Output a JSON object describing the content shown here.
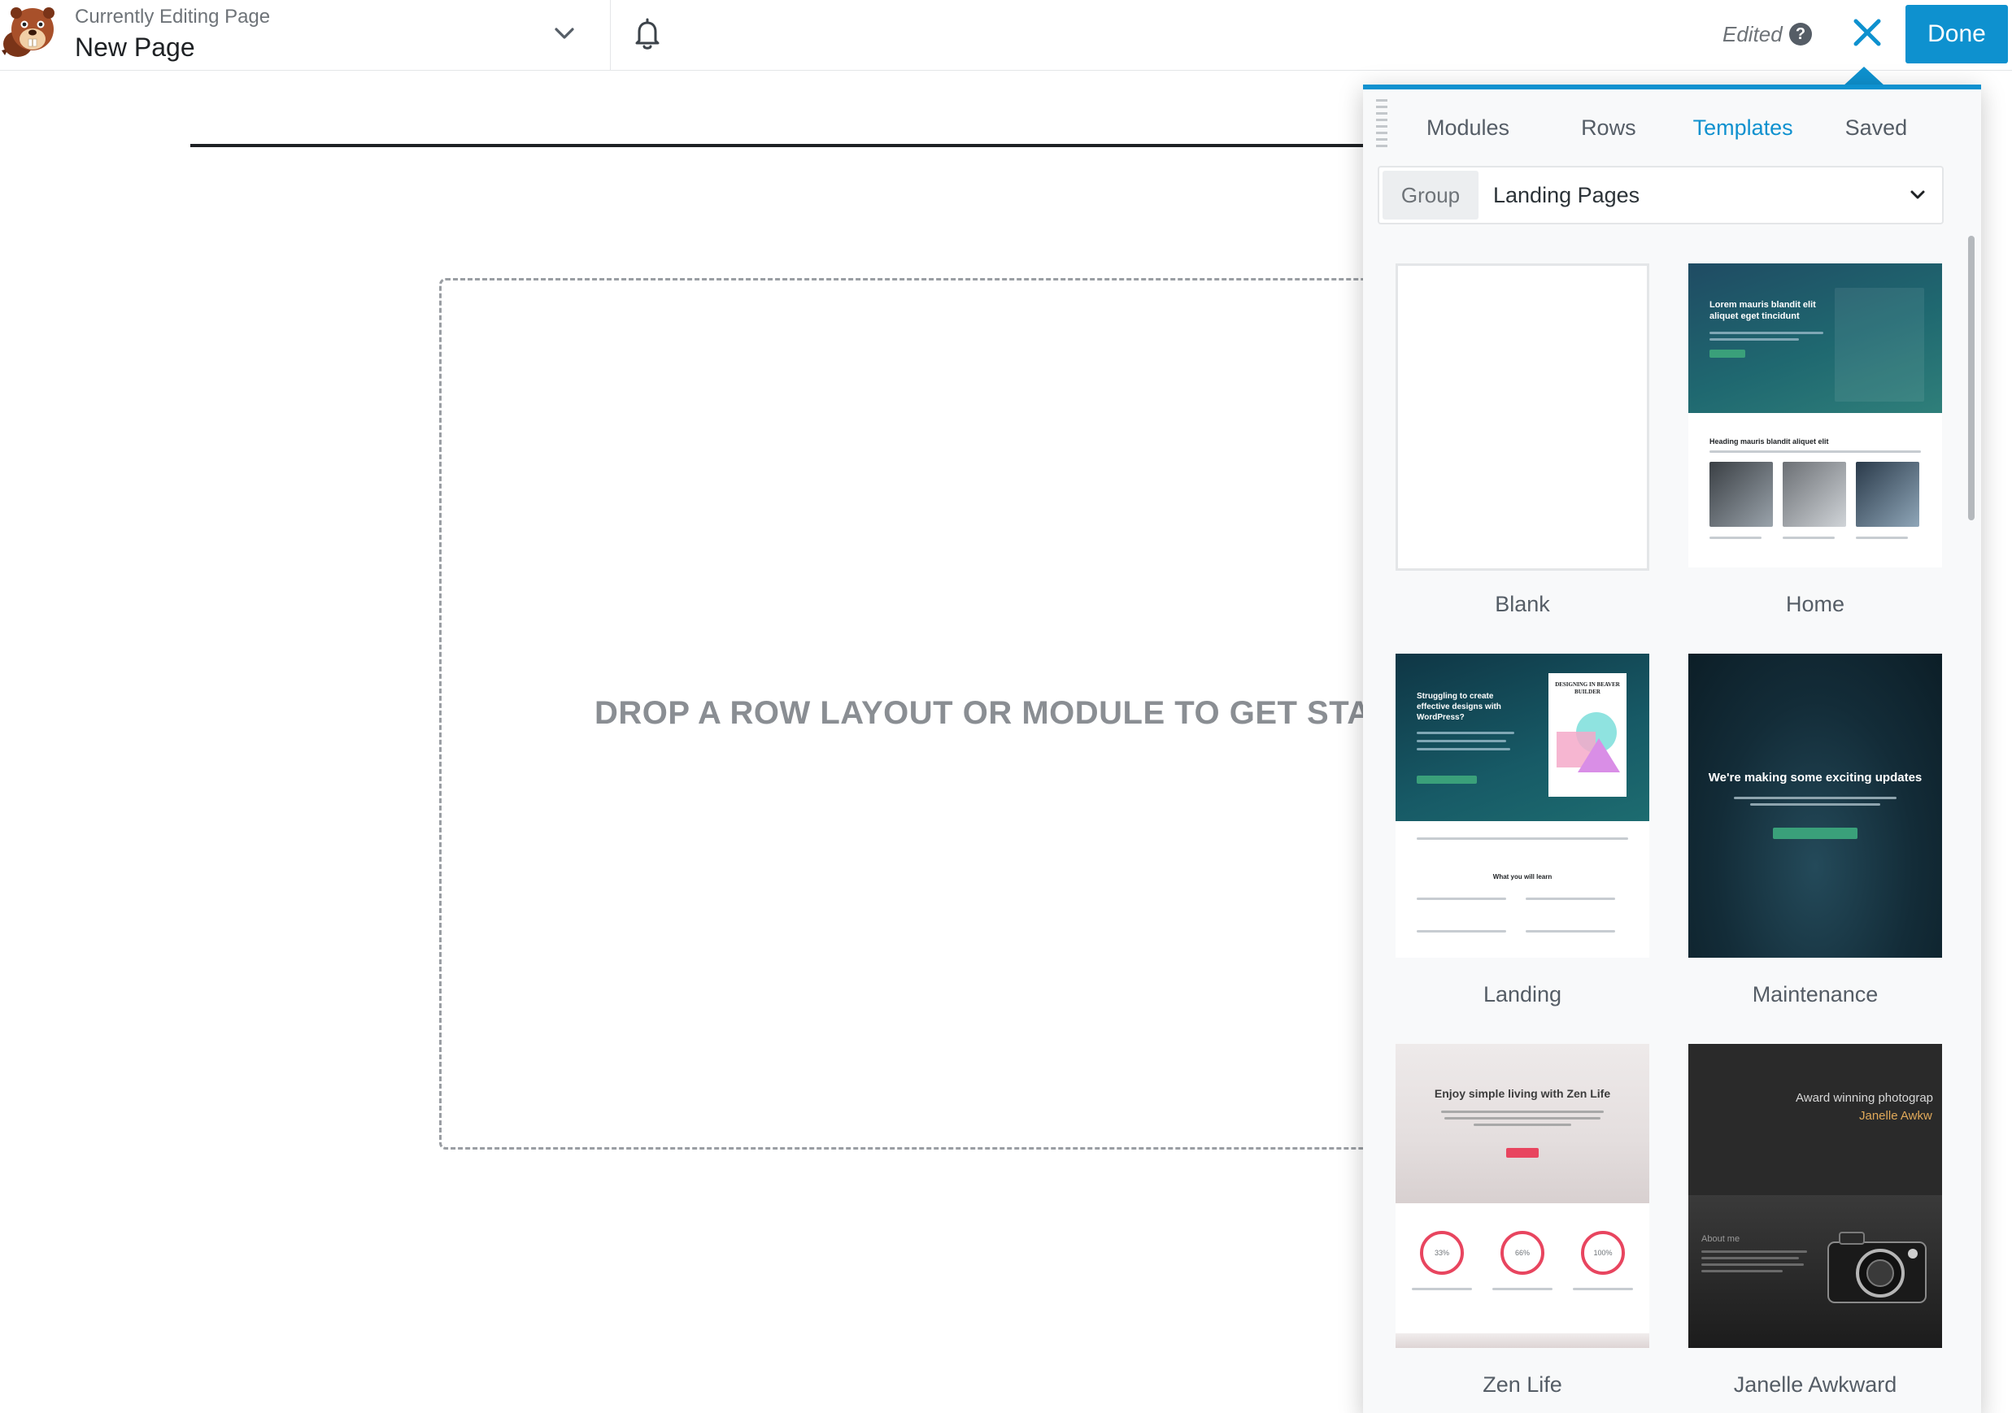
{
  "header": {
    "subtitle": "Currently Editing Page",
    "title": "New Page",
    "status": "Edited",
    "help_glyph": "?",
    "done_label": "Done"
  },
  "canvas": {
    "drop_text": "DROP A ROW LAYOUT OR MODULE TO GET START"
  },
  "panel": {
    "tabs": [
      {
        "label": "Modules",
        "active": false
      },
      {
        "label": "Rows",
        "active": false
      },
      {
        "label": "Templates",
        "active": true
      },
      {
        "label": "Saved",
        "active": false
      }
    ],
    "group": {
      "label": "Group",
      "value": "Landing Pages"
    },
    "templates": [
      {
        "name": "Blank"
      },
      {
        "name": "Home"
      },
      {
        "name": "Landing"
      },
      {
        "name": "Maintenance"
      },
      {
        "name": "Zen Life"
      },
      {
        "name": "Janelle Awkward"
      }
    ]
  },
  "thumbnails": {
    "home": {
      "hero_title": "Lorem mauris blandit elit aliquet eget tincidunt",
      "section_heading": "Heading mauris blandit aliquet elit"
    },
    "landing": {
      "hero_title": "Struggling to create effective designs with WordPress?",
      "book_title": "DESIGNING IN BEAVER BUILDER",
      "learn_heading": "What you will learn"
    },
    "maintenance": {
      "hero_title": "We're making some exciting updates"
    },
    "zen": {
      "hero_title": "Enjoy simple living with Zen Life",
      "rings": [
        "33%",
        "66%",
        "100%"
      ]
    },
    "janelle": {
      "headline": "Award winning photograp",
      "name": "Janelle Awkw",
      "about": "About me"
    }
  },
  "colors": {
    "accent": "#0e91cf",
    "text_muted": "#6e7378",
    "canvas_border": "#9a9ea3",
    "panel_bg": "#f8f9fa"
  },
  "icons": {
    "logo": "beaver-logo-icon",
    "title_dropdown": "chevron-down-icon",
    "notifications": "bell-icon",
    "help": "question-circle-icon",
    "close": "close-icon",
    "drag": "drag-handle-icon",
    "group_dropdown": "chevron-down-icon"
  }
}
